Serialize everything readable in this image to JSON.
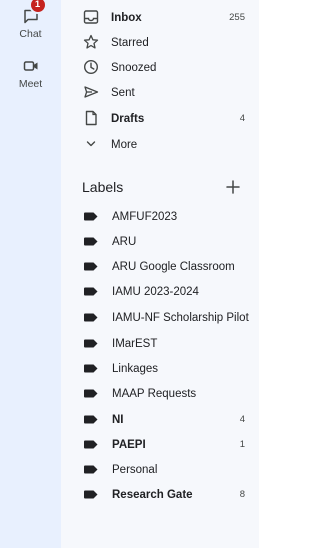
{
  "rail": {
    "chat": {
      "label": "Chat",
      "badge": "1"
    },
    "meet": {
      "label": "Meet"
    }
  },
  "nav": [
    {
      "name": "Inbox",
      "count": "255",
      "bold": true,
      "icon": "inbox-icon"
    },
    {
      "name": "Starred",
      "count": "",
      "bold": false,
      "icon": "star-icon"
    },
    {
      "name": "Snoozed",
      "count": "",
      "bold": false,
      "icon": "clock-icon"
    },
    {
      "name": "Sent",
      "count": "",
      "bold": false,
      "icon": "send-icon"
    },
    {
      "name": "Drafts",
      "count": "4",
      "bold": true,
      "icon": "draft-icon"
    },
    {
      "name": "More",
      "count": "",
      "bold": false,
      "icon": "chevron-down-icon"
    }
  ],
  "labels": {
    "title": "Labels",
    "items": [
      {
        "name": "AMFUF2023",
        "count": "",
        "bold": false
      },
      {
        "name": "ARU",
        "count": "",
        "bold": false
      },
      {
        "name": "ARU Google Classroom",
        "count": "",
        "bold": false
      },
      {
        "name": "IAMU 2023-2024",
        "count": "",
        "bold": false
      },
      {
        "name": "IAMU-NF Scholarship Pilot",
        "count": "",
        "bold": false
      },
      {
        "name": "IMarEST",
        "count": "",
        "bold": false
      },
      {
        "name": "Linkages",
        "count": "",
        "bold": false
      },
      {
        "name": "MAAP Requests",
        "count": "",
        "bold": false
      },
      {
        "name": "NI",
        "count": "4",
        "bold": true
      },
      {
        "name": "PAEPI",
        "count": "1",
        "bold": true
      },
      {
        "name": "Personal",
        "count": "",
        "bold": false
      },
      {
        "name": "Research Gate",
        "count": "8",
        "bold": true
      }
    ]
  },
  "colors": {
    "rail_bg": "#e8f0fe",
    "panel_bg": "#f6f8fc",
    "badge": "#c5221f",
    "icon": "#444746",
    "text": "#202124"
  }
}
